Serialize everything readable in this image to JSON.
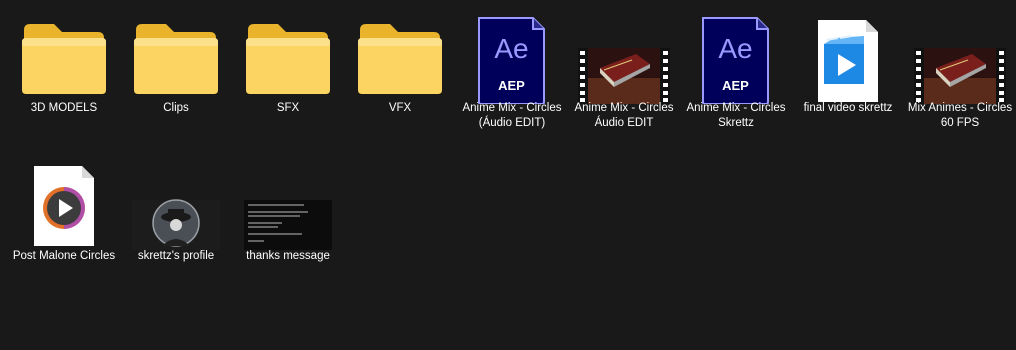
{
  "items": [
    {
      "name": "3D MODELS",
      "type": "folder",
      "icon": "folder-icon"
    },
    {
      "name": "Clips",
      "type": "folder",
      "icon": "folder-icon"
    },
    {
      "name": "SFX",
      "type": "folder",
      "icon": "folder-icon"
    },
    {
      "name": "VFX",
      "type": "folder",
      "icon": "folder-icon"
    },
    {
      "name": "Anime Mix - Circles (Áudio EDIT)",
      "type": "after-effects-project",
      "icon": "after-effects-icon",
      "badge": "AEP",
      "logo": "Ae"
    },
    {
      "name": "Anime Mix - Circles Áudio EDIT",
      "type": "video",
      "icon": "video-thumbnail-icon"
    },
    {
      "name": "Anime Mix - Circles Skrettz",
      "type": "after-effects-project",
      "icon": "after-effects-icon",
      "badge": "AEP",
      "logo": "Ae"
    },
    {
      "name": "final video skrettz",
      "type": "video-file",
      "icon": "video-file-icon"
    },
    {
      "name": "Mix Animes - Circles 60 FPS",
      "type": "video",
      "icon": "video-thumbnail-icon"
    },
    {
      "name": "Post Malone Circles",
      "type": "media-file",
      "icon": "media-player-file-icon"
    },
    {
      "name": "skrettz's profile",
      "type": "image",
      "icon": "profile-image-thumbnail"
    },
    {
      "name": "thanks message",
      "type": "image",
      "icon": "text-image-thumbnail"
    }
  ],
  "colors": {
    "background": "#191919",
    "folder": "#f8c93a",
    "after_effects_bg": "#00005b",
    "after_effects_accent": "#9999ff"
  }
}
